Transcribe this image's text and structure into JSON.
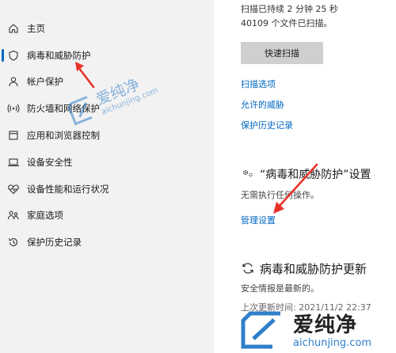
{
  "sidebar": {
    "items": [
      {
        "label": "主页",
        "icon": "home-icon"
      },
      {
        "label": "病毒和威胁防护",
        "icon": "shield-icon"
      },
      {
        "label": "帐户保护",
        "icon": "person-icon"
      },
      {
        "label": "防火墙和网络保护",
        "icon": "wifi-signal-icon"
      },
      {
        "label": "应用和浏览器控制",
        "icon": "app-window-icon"
      },
      {
        "label": "设备安全性",
        "icon": "laptop-icon"
      },
      {
        "label": "设备性能和运行状况",
        "icon": "heart-pulse-icon"
      },
      {
        "label": "家庭选项",
        "icon": "family-icon"
      },
      {
        "label": "保护历史记录",
        "icon": "history-icon"
      }
    ]
  },
  "main": {
    "scan_status": "扫描已持续 2 分钟 25 秒",
    "files_scanned": "40109 个文件已扫描。",
    "quick_scan_button": "快速扫描",
    "links": [
      "扫描选项",
      "允许的威胁",
      "保护历史记录"
    ],
    "settings_section": {
      "title": "“病毒和威胁防护”设置",
      "description": "无需执行任何操作。",
      "manage_link": "管理设置"
    },
    "updates_section": {
      "title": "病毒和威胁防护更新",
      "description": "安全情报是最新的。",
      "last_update": "上次更新时间: 2021/11/2 22:37"
    }
  },
  "watermarks": {
    "diagonal_cn": "爱纯净",
    "diagonal_url": "aichunjing.com",
    "corner_cn": "爱纯净",
    "corner_url": "aichunjing.com"
  },
  "colors": {
    "accent": "#0067c0",
    "arrow": "#e8332a",
    "watermark": "#2f7fc9",
    "sidebar_bg": "#f2f2f2",
    "button_bg": "#cfcfcf"
  }
}
